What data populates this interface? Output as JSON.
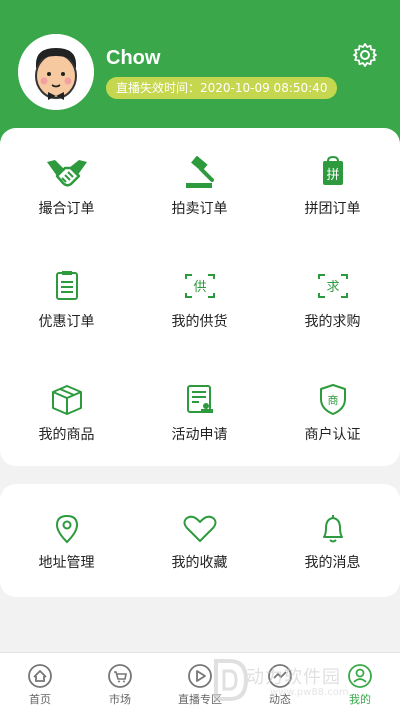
{
  "profile": {
    "username": "Chow",
    "expiry_text": "直播失效时间：2020-10-09 08:50:40"
  },
  "colors": {
    "primary": "#3aa84a",
    "badge": "#c4d74f"
  },
  "grid": [
    {
      "label": "撮合订单",
      "icon": "handshake-icon"
    },
    {
      "label": "拍卖订单",
      "icon": "auction-hammer-icon"
    },
    {
      "label": "拼团订单",
      "icon": "group-buy-icon"
    },
    {
      "label": "优惠订单",
      "icon": "clipboard-icon"
    },
    {
      "label": "我的供货",
      "icon": "supply-icon"
    },
    {
      "label": "我的求购",
      "icon": "request-icon"
    },
    {
      "label": "我的商品",
      "icon": "box-icon"
    },
    {
      "label": "活动申请",
      "icon": "form-stamp-icon"
    },
    {
      "label": "商户认证",
      "icon": "merchant-shield-icon"
    }
  ],
  "grid2": [
    {
      "label": "地址管理",
      "icon": "location-pin-icon"
    },
    {
      "label": "我的收藏",
      "icon": "heart-icon"
    },
    {
      "label": "我的消息",
      "icon": "bell-icon"
    }
  ],
  "tabs": [
    {
      "label": "首页",
      "icon": "home-icon"
    },
    {
      "label": "市场",
      "icon": "cart-icon"
    },
    {
      "label": "直播专区",
      "icon": "play-icon"
    },
    {
      "label": "动态",
      "icon": "trend-icon"
    },
    {
      "label": "我的",
      "icon": "profile-icon"
    }
  ],
  "watermark": {
    "text": "动力软件园",
    "sub": "www.pw88.com"
  }
}
